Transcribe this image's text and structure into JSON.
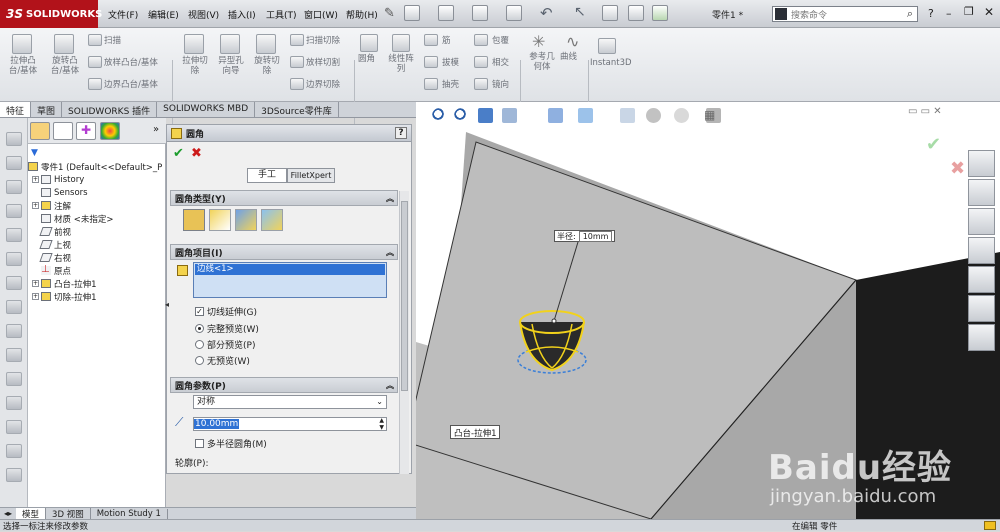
{
  "app": {
    "logo": "SOLIDWORKS",
    "logo_prefix": "3S",
    "document_title": "零件1 *",
    "search_placeholder": "搜索命令"
  },
  "menu": [
    "文件(F)",
    "编辑(E)",
    "视图(V)",
    "插入(I)",
    "工具(T)",
    "窗口(W)",
    "帮助(H)"
  ],
  "help_icon": "?",
  "cmd": {
    "extrude_boss": "拉伸凸\n台/基体",
    "revolve_boss": "旋转凸\n台/基体",
    "sweep": "扫描",
    "loft": "放样凸台/基体",
    "boundary": "边界凸台/基体",
    "extrude_cut": "拉伸切\n除",
    "hole_wizard": "异型孔\n向导",
    "revolve_cut": "旋转切\n除",
    "swept_cut": "扫描切除",
    "lofted_cut": "放样切割",
    "boundary_cut": "边界切除",
    "fillet": "圆角",
    "linear_pattern": "线性阵\n列",
    "rib": "筋",
    "draft": "拔模",
    "shell": "抽壳",
    "wrap": "包覆",
    "intersect": "相交",
    "mirror": "镜向",
    "ref_geometry": "参考几\n何体",
    "curves": "曲线",
    "instant3d": "Instant3D"
  },
  "tabs": [
    "特征",
    "草图",
    "SOLIDWORKS 插件",
    "SOLIDWORKS MBD",
    "3DSource零件库"
  ],
  "tree": {
    "root": "零件1  (Default<<Default>_P",
    "items": [
      "History",
      "Sensors",
      "注解",
      "材质 <未指定>",
      "前视",
      "上视",
      "右视",
      "原点",
      "凸台-拉伸1",
      "切除-拉伸1"
    ]
  },
  "pm": {
    "title": "圆角",
    "tab_manual": "手工",
    "tab_xpert": "FilletXpert",
    "group_type": "圆角类型(Y)",
    "group_items": "圆角项目(I)",
    "edge_item": "边线<1>",
    "tangent": "切线延伸(G)",
    "full_preview": "完整预览(W)",
    "partial_preview": "部分预览(P)",
    "no_preview": "无预览(W)",
    "group_params": "圆角参数(P)",
    "symmetric": "对称",
    "radius_value": "10.00mm",
    "multi_radius": "多半径圆角(M)",
    "profile": "轮廓(P):"
  },
  "viewport": {
    "callout_label": "半径:",
    "callout_value": "10mm",
    "feature_label": "凸台-拉伸1"
  },
  "bottom_tabs": [
    "模型",
    "3D 视图",
    "Motion Study 1"
  ],
  "status": {
    "left": "选择一标注来修改参数",
    "right": "在编辑 零件"
  },
  "watermark": {
    "brand": "Baidu经验",
    "url": "jingyan.baidu.com"
  },
  "colors": {
    "logo_red": "#b2121a",
    "highlight_yellow": "#f2d21b",
    "preview_blue": "#3a7fd8",
    "body_gray": "#bfbfbf",
    "dark_face": "#1c1c1c"
  }
}
